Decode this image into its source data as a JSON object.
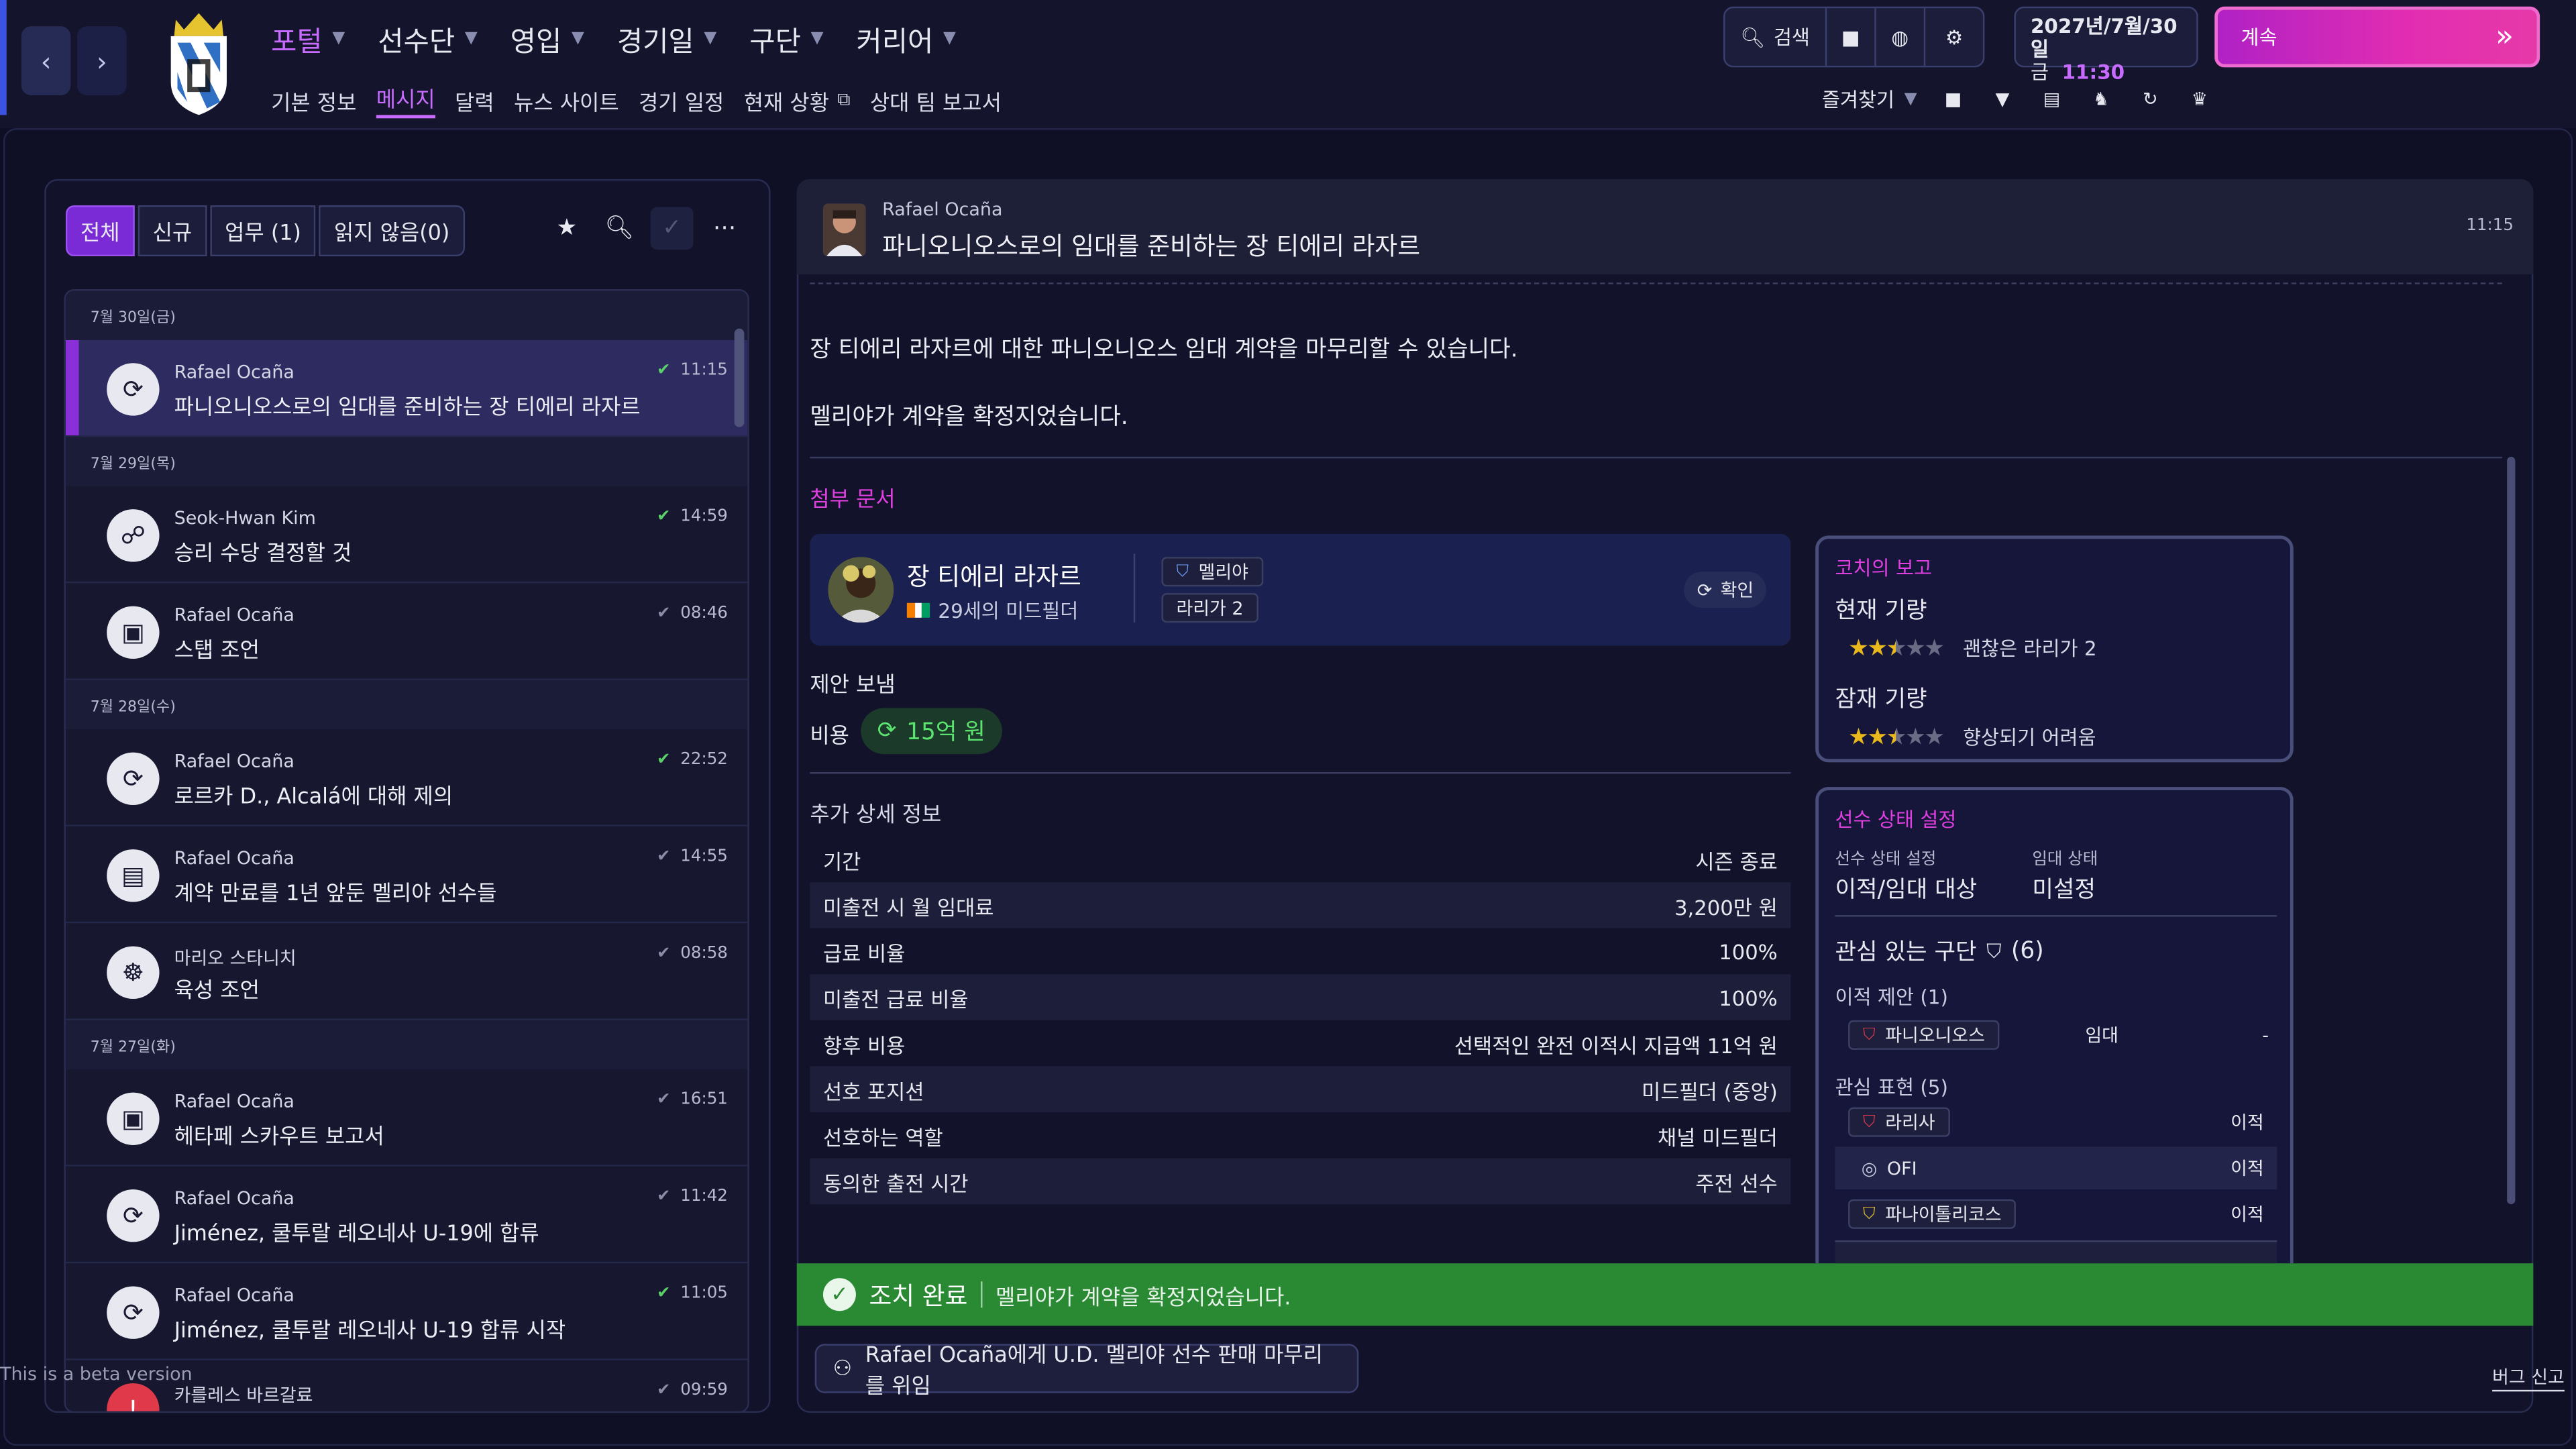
{
  "topnav": {
    "menu": [
      {
        "label": "포털",
        "active": true
      },
      {
        "label": "선수단",
        "active": false
      },
      {
        "label": "영입",
        "active": false
      },
      {
        "label": "경기일",
        "active": false
      },
      {
        "label": "구단",
        "active": false
      },
      {
        "label": "커리어",
        "active": false
      }
    ],
    "submenu": [
      "기본 정보",
      "메시지",
      "달력",
      "뉴스 사이트",
      "경기 일정",
      "현재 상황",
      "상대 팀 보고서"
    ],
    "submenu_active": "메시지",
    "search_label": "검색",
    "date_line1": "2027년/7월/30일",
    "date_weekday": "금",
    "date_time": "11:30",
    "continue_label": "계속",
    "favorites_label": "즐겨찾기"
  },
  "inbox": {
    "filters": [
      "전체",
      "신규",
      "업무 (1)",
      "읽지 않음(0)"
    ],
    "groups": [
      {
        "day": "7월 30일(금)",
        "messages": [
          {
            "sender": "Rafael Ocaña",
            "subject": "파니오니오스로의 임대를 준비하는 장 티에리 라자르",
            "time": "11:15",
            "icon": "sync-icon",
            "read": true,
            "selected": true
          }
        ]
      },
      {
        "day": "7월 29일(목)",
        "messages": [
          {
            "sender": "Seok-Hwan Kim",
            "subject": "승리 수당 결정할 것",
            "time": "14:59",
            "icon": "people-icon",
            "read": true
          },
          {
            "sender": "Rafael Ocaña",
            "subject": "스탭 조언",
            "time": "08:46",
            "icon": "briefcase-icon",
            "read": false
          }
        ]
      },
      {
        "day": "7월 28일(수)",
        "messages": [
          {
            "sender": "Rafael Ocaña",
            "subject": "로르카 D., Alcalá에 대해 제의",
            "time": "22:52",
            "icon": "sync-icon",
            "read": true
          },
          {
            "sender": "Rafael Ocaña",
            "subject": "계약 만료를 1년 앞둔 멜리야 선수들",
            "time": "14:55",
            "icon": "contract-icon",
            "read": false
          },
          {
            "sender": "마리오 스타니치",
            "subject": "육성 조언",
            "time": "08:58",
            "icon": "group-icon",
            "read": false
          }
        ]
      },
      {
        "day": "7월 27일(화)",
        "messages": [
          {
            "sender": "Rafael Ocaña",
            "subject": "헤타페 스카우트 보고서",
            "time": "16:51",
            "icon": "briefcase-icon",
            "read": false
          },
          {
            "sender": "Rafael Ocaña",
            "subject": "Jiménez, 쿨투랄 레오네사 U-19에 합류",
            "time": "11:42",
            "icon": "sync-icon",
            "read": false
          },
          {
            "sender": "Rafael Ocaña",
            "subject": "Jiménez, 쿨투랄 레오네사 U-19 합류 시작",
            "time": "11:05",
            "icon": "sync-icon",
            "read": true
          },
          {
            "sender": "카를레스 바르갈료",
            "subject": "",
            "time": "09:59",
            "icon": "alert-icon",
            "read": false
          }
        ]
      }
    ],
    "beta_notice": "This is a beta version"
  },
  "message": {
    "sender": "Rafael Ocaña",
    "subject": "파니오니오스로의 임대를 준비하는 장 티에리 라자르",
    "time": "11:15",
    "body1": "장 티에리 라자르에 대한 파니오니오스 임대 계약을 마무리할 수 있습니다.",
    "body2": "멜리야가 계약을 확정지었습니다.",
    "attach_label": "첨부 문서",
    "player": {
      "name": "장 티에리 라자르",
      "desc": "29세의 미드필더",
      "club": "멜리야",
      "league": "라리가 2",
      "confirm": "확인"
    },
    "offer_sent": "제안 보냄",
    "fee_label": "비용",
    "fee_value": "15억 원",
    "details_title": "추가 상세 정보",
    "details": [
      {
        "k": "기간",
        "v": "시즌 종료"
      },
      {
        "k": "미출전 시 월 임대료",
        "v": "3,200만 원"
      },
      {
        "k": "급료 비율",
        "v": "100%"
      },
      {
        "k": "미출전 급료 비율",
        "v": "100%"
      },
      {
        "k": "향후 비용",
        "v": "선택적인 완전 이적시 지급액 11억 원"
      },
      {
        "k": "선호 포지션",
        "v": "미드필더 (중앙)"
      },
      {
        "k": "선호하는 역할",
        "v": "채널 미드필더"
      },
      {
        "k": "동의한 출전 시간",
        "v": "주전 선수"
      }
    ],
    "coach_report": {
      "title": "코치의 보고",
      "current_label": "현재 기량",
      "current_stars": 2.5,
      "current_text": "괜찮은 라리가 2",
      "potential_label": "잠재 기량",
      "potential_stars": 2.5,
      "potential_text": "향상되기 어려움"
    },
    "status": {
      "title": "선수 상태 설정",
      "player_status_label": "선수 상태 설정",
      "player_status": "이적/임대 대상",
      "loan_status_label": "임대 상태",
      "loan_status": "미설정",
      "interested_title": "관심 있는 구단",
      "interested_count": "(6)",
      "offers_label": "이적 제안 (1)",
      "offers": [
        {
          "club": "파니오니오스",
          "type": "임대",
          "extra": "-"
        }
      ],
      "interest_label": "관심 표현 (5)",
      "interests": [
        {
          "club": "라리사",
          "type": "이적"
        },
        {
          "club": "OFI",
          "type": "이적"
        },
        {
          "club": "파나이톨리코스",
          "type": "이적"
        }
      ]
    },
    "action_done": "조치 완료",
    "action_text": "멜리야가 계약을 확정지었습니다.",
    "delegate_label": "Rafael Ocaña에게 U.D. 멜리야 선수 판매 마무리를 위임"
  },
  "bug_report": "버그 신고",
  "colors": {
    "accent": "#c86bff",
    "continue_start": "#b021c5",
    "success": "#2a8a34",
    "panel": "#12132a"
  }
}
